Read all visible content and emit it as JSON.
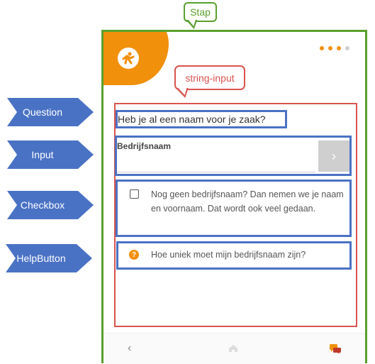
{
  "annotations": {
    "step_label": "Stap",
    "component_label": "string-input",
    "arrows": [
      "Question",
      "Input",
      "Checkbox",
      "HelpButton"
    ]
  },
  "form": {
    "question": "Heb je al een naam voor je zaak?",
    "input_label": "Bedrijfsnaam",
    "input_value": "",
    "submit_icon": "chevron-right-icon",
    "checkbox_text": "Nog geen bedrijfsnaam? Dan nemen we je naam en voornaam. Dat wordt ook veel gedaan.",
    "checkbox_checked": false,
    "help_text": "Hoe uniek moet mijn bedrijfsnaam zijn?"
  },
  "progress": {
    "total_steps": 4,
    "active_steps": 3
  },
  "colors": {
    "brand": "#f0900b",
    "step_outline": "#5aa02c",
    "component_outline": "#d9534f",
    "element_outline": "#4a72c4",
    "arrow_fill": "#4a72c4"
  },
  "nav": {
    "icons": [
      "chevron-left-icon",
      "home-icon",
      "chat-icon"
    ]
  }
}
